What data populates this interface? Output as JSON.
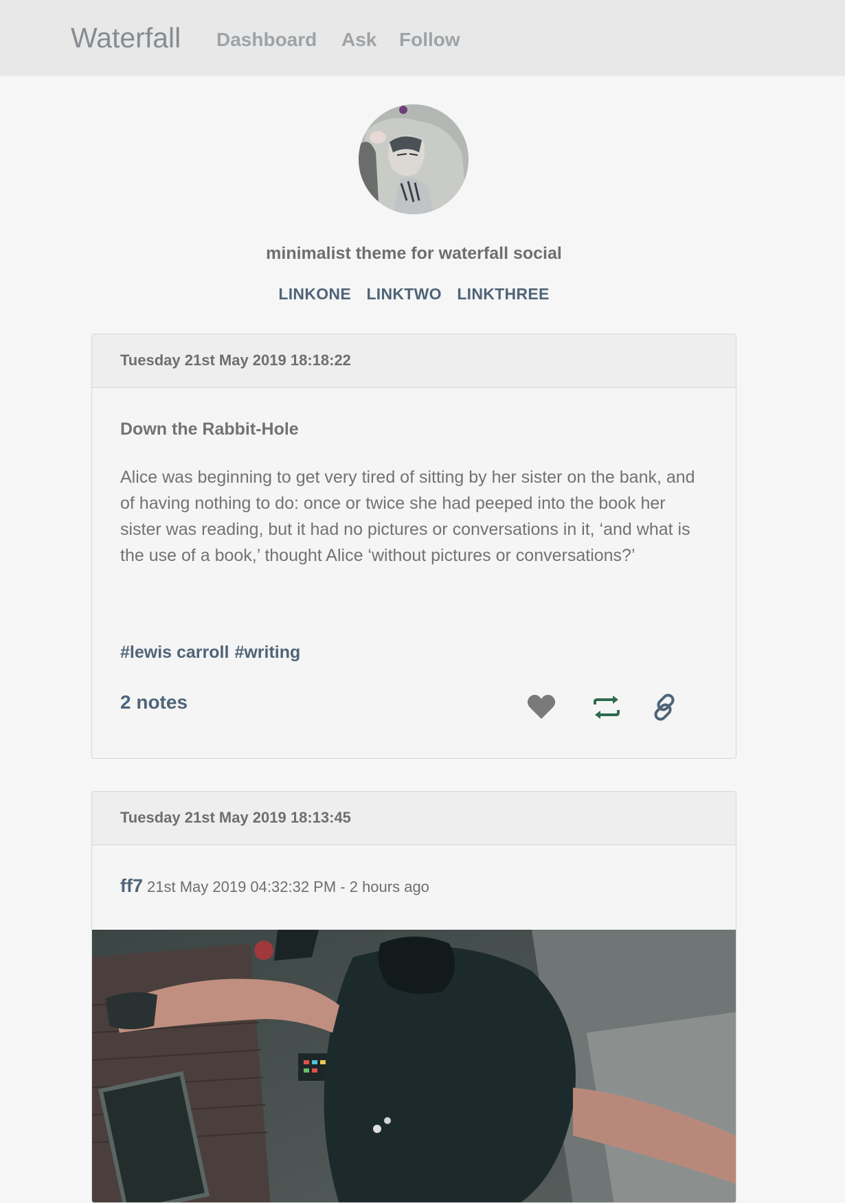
{
  "nav": {
    "brand": "Waterfall",
    "links": [
      "Dashboard",
      "Ask",
      "Follow"
    ]
  },
  "profile": {
    "avatar": "avatar-illustration",
    "tagline": "minimalist theme for waterfall social",
    "links": [
      "LINKONE",
      "LINKTWO",
      "LINKTHREE"
    ]
  },
  "posts": [
    {
      "timestamp": "Tuesday 21st May 2019 18:18:22",
      "title": "Down the Rabbit-Hole",
      "body": "Alice was beginning to get very tired of sitting by her sister on the bank, and of having nothing to do: once or twice she had peeped into the book her sister was reading, but it had no pictures or conversations in it, ‘and what is the use of a book,’ thought Alice ‘without pictures or conversations?’",
      "tags": [
        "#lewis carroll",
        "#writing"
      ],
      "notes": "2 notes",
      "icons": {
        "like": "heart-icon",
        "reblog": "reblog-icon",
        "permalink": "link-icon"
      }
    },
    {
      "timestamp": "Tuesday 21st May 2019 18:13:45",
      "source_name": "ff7",
      "source_time": "21st May 2019 04:32:32 PM - 2 hours ago",
      "image": "action-scene-image"
    }
  ],
  "colors": {
    "accent": "#4f6478",
    "reblog": "#2f6a4e",
    "like": "#7a7a7a",
    "header_bg": "#e8e8e8",
    "page_bg": "#f6f6f6"
  }
}
